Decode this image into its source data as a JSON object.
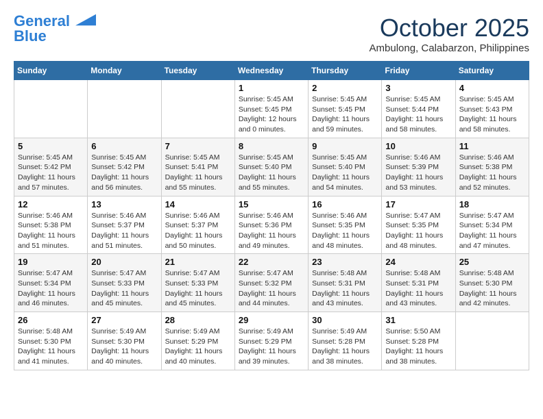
{
  "logo": {
    "text1": "General",
    "text2": "Blue"
  },
  "title": "October 2025",
  "location": "Ambulong, Calabarzon, Philippines",
  "weekdays": [
    "Sunday",
    "Monday",
    "Tuesday",
    "Wednesday",
    "Thursday",
    "Friday",
    "Saturday"
  ],
  "weeks": [
    [
      {
        "day": "",
        "info": ""
      },
      {
        "day": "",
        "info": ""
      },
      {
        "day": "",
        "info": ""
      },
      {
        "day": "1",
        "info": "Sunrise: 5:45 AM\nSunset: 5:45 PM\nDaylight: 12 hours\nand 0 minutes."
      },
      {
        "day": "2",
        "info": "Sunrise: 5:45 AM\nSunset: 5:45 PM\nDaylight: 11 hours\nand 59 minutes."
      },
      {
        "day": "3",
        "info": "Sunrise: 5:45 AM\nSunset: 5:44 PM\nDaylight: 11 hours\nand 58 minutes."
      },
      {
        "day": "4",
        "info": "Sunrise: 5:45 AM\nSunset: 5:43 PM\nDaylight: 11 hours\nand 58 minutes."
      }
    ],
    [
      {
        "day": "5",
        "info": "Sunrise: 5:45 AM\nSunset: 5:42 PM\nDaylight: 11 hours\nand 57 minutes."
      },
      {
        "day": "6",
        "info": "Sunrise: 5:45 AM\nSunset: 5:42 PM\nDaylight: 11 hours\nand 56 minutes."
      },
      {
        "day": "7",
        "info": "Sunrise: 5:45 AM\nSunset: 5:41 PM\nDaylight: 11 hours\nand 55 minutes."
      },
      {
        "day": "8",
        "info": "Sunrise: 5:45 AM\nSunset: 5:40 PM\nDaylight: 11 hours\nand 55 minutes."
      },
      {
        "day": "9",
        "info": "Sunrise: 5:45 AM\nSunset: 5:40 PM\nDaylight: 11 hours\nand 54 minutes."
      },
      {
        "day": "10",
        "info": "Sunrise: 5:46 AM\nSunset: 5:39 PM\nDaylight: 11 hours\nand 53 minutes."
      },
      {
        "day": "11",
        "info": "Sunrise: 5:46 AM\nSunset: 5:38 PM\nDaylight: 11 hours\nand 52 minutes."
      }
    ],
    [
      {
        "day": "12",
        "info": "Sunrise: 5:46 AM\nSunset: 5:38 PM\nDaylight: 11 hours\nand 51 minutes."
      },
      {
        "day": "13",
        "info": "Sunrise: 5:46 AM\nSunset: 5:37 PM\nDaylight: 11 hours\nand 51 minutes."
      },
      {
        "day": "14",
        "info": "Sunrise: 5:46 AM\nSunset: 5:37 PM\nDaylight: 11 hours\nand 50 minutes."
      },
      {
        "day": "15",
        "info": "Sunrise: 5:46 AM\nSunset: 5:36 PM\nDaylight: 11 hours\nand 49 minutes."
      },
      {
        "day": "16",
        "info": "Sunrise: 5:46 AM\nSunset: 5:35 PM\nDaylight: 11 hours\nand 48 minutes."
      },
      {
        "day": "17",
        "info": "Sunrise: 5:47 AM\nSunset: 5:35 PM\nDaylight: 11 hours\nand 48 minutes."
      },
      {
        "day": "18",
        "info": "Sunrise: 5:47 AM\nSunset: 5:34 PM\nDaylight: 11 hours\nand 47 minutes."
      }
    ],
    [
      {
        "day": "19",
        "info": "Sunrise: 5:47 AM\nSunset: 5:34 PM\nDaylight: 11 hours\nand 46 minutes."
      },
      {
        "day": "20",
        "info": "Sunrise: 5:47 AM\nSunset: 5:33 PM\nDaylight: 11 hours\nand 45 minutes."
      },
      {
        "day": "21",
        "info": "Sunrise: 5:47 AM\nSunset: 5:33 PM\nDaylight: 11 hours\nand 45 minutes."
      },
      {
        "day": "22",
        "info": "Sunrise: 5:47 AM\nSunset: 5:32 PM\nDaylight: 11 hours\nand 44 minutes."
      },
      {
        "day": "23",
        "info": "Sunrise: 5:48 AM\nSunset: 5:31 PM\nDaylight: 11 hours\nand 43 minutes."
      },
      {
        "day": "24",
        "info": "Sunrise: 5:48 AM\nSunset: 5:31 PM\nDaylight: 11 hours\nand 43 minutes."
      },
      {
        "day": "25",
        "info": "Sunrise: 5:48 AM\nSunset: 5:30 PM\nDaylight: 11 hours\nand 42 minutes."
      }
    ],
    [
      {
        "day": "26",
        "info": "Sunrise: 5:48 AM\nSunset: 5:30 PM\nDaylight: 11 hours\nand 41 minutes."
      },
      {
        "day": "27",
        "info": "Sunrise: 5:49 AM\nSunset: 5:30 PM\nDaylight: 11 hours\nand 40 minutes."
      },
      {
        "day": "28",
        "info": "Sunrise: 5:49 AM\nSunset: 5:29 PM\nDaylight: 11 hours\nand 40 minutes."
      },
      {
        "day": "29",
        "info": "Sunrise: 5:49 AM\nSunset: 5:29 PM\nDaylight: 11 hours\nand 39 minutes."
      },
      {
        "day": "30",
        "info": "Sunrise: 5:49 AM\nSunset: 5:28 PM\nDaylight: 11 hours\nand 38 minutes."
      },
      {
        "day": "31",
        "info": "Sunrise: 5:50 AM\nSunset: 5:28 PM\nDaylight: 11 hours\nand 38 minutes."
      },
      {
        "day": "",
        "info": ""
      }
    ]
  ]
}
